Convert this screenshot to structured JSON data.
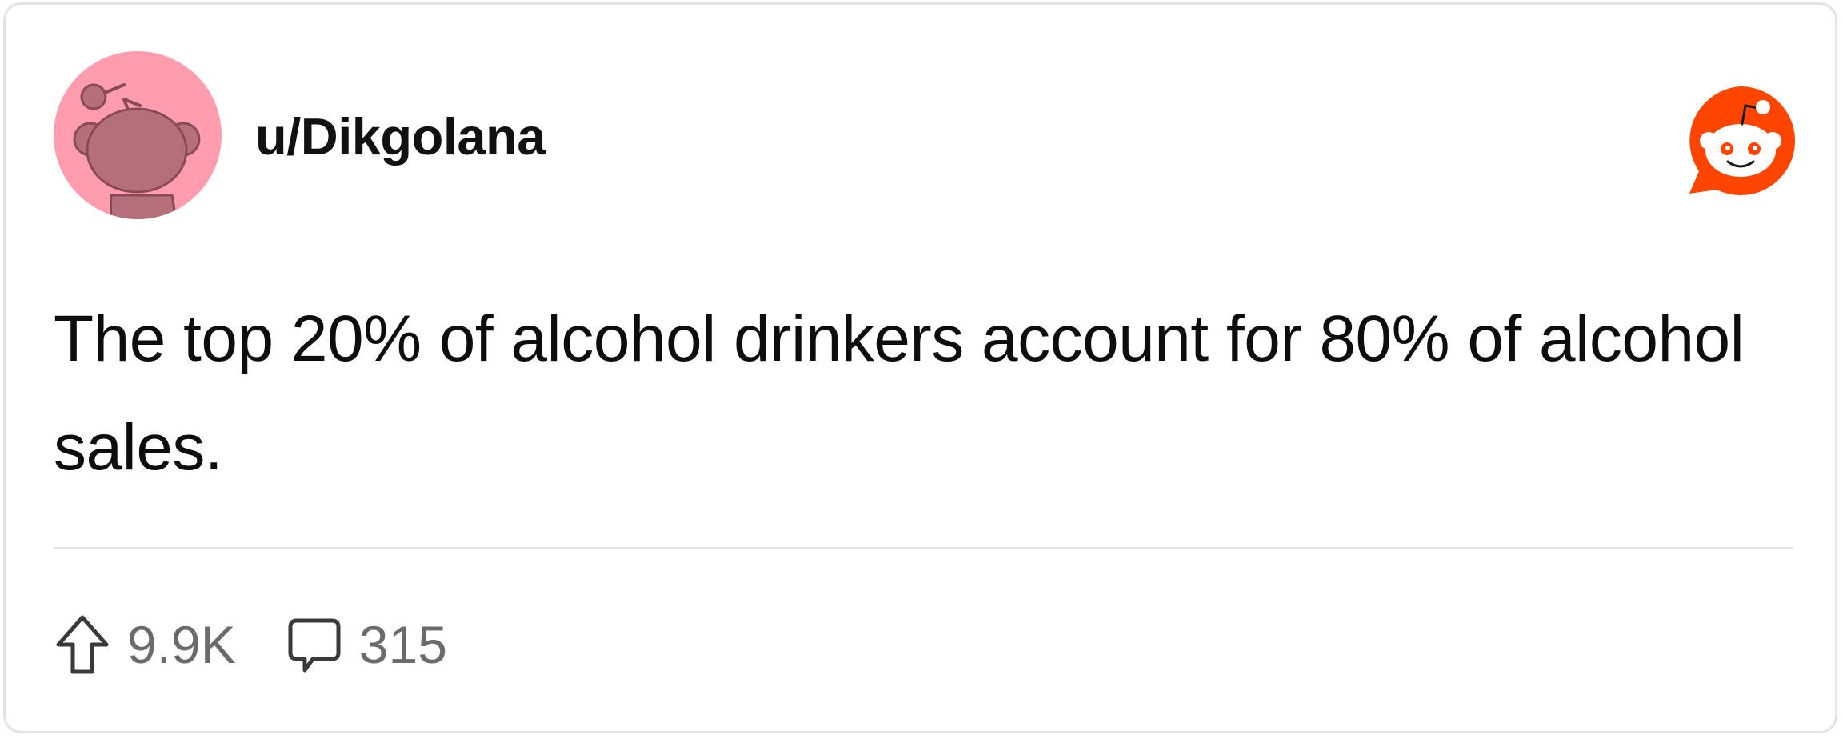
{
  "post": {
    "username": "u/Dikgolana",
    "body": "The top 20% of alcohol drinkers account for 80% of alcohol sales.",
    "upvotes": "9.9K",
    "comments": "315"
  },
  "icons": {
    "avatar": "snoo-avatar",
    "brand": "reddit-logo-icon",
    "upvote": "upvote-arrow-icon",
    "comment": "comment-bubble-icon"
  },
  "colors": {
    "avatar_bg": "#ff9daf",
    "brand": "#ff4500",
    "text": "#0d0d0d",
    "muted": "#6b6b6b",
    "divider": "#e2e2e2"
  }
}
